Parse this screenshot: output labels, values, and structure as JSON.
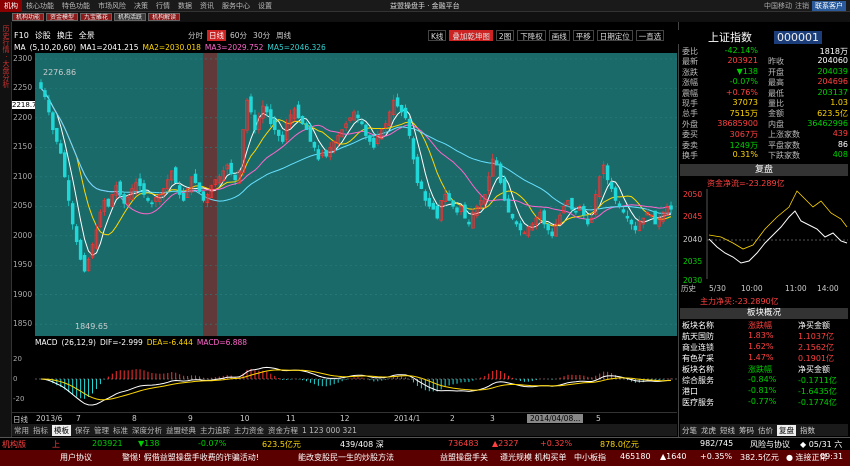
{
  "app": {
    "logo": "机构",
    "title": "益盟操盘手 · 金融平台"
  },
  "menu": [
    "核心功能",
    "特色功能",
    "市场风险",
    "决策",
    "行情",
    "数据",
    "资讯",
    "服务中心",
    "设置"
  ],
  "top_right": {
    "label": "中国移动",
    "btn": "联系客户",
    "user": "注销"
  },
  "toolbar2": [
    "机构功能",
    "资金模型",
    "九宝雕花",
    "机构活跃",
    "机构解读"
  ],
  "left_strip_text": "历史行情 · 大盘分析",
  "chart_head": {
    "code": "F10",
    "items": [
      "诊股",
      "换庄",
      "全景"
    ]
  },
  "periods": [
    "分时",
    "日线",
    "60分",
    "30分",
    "周线"
  ],
  "period_active": "日线",
  "right_controls": [
    "K线",
    "叠加乾坤图",
    "2图",
    "下降权",
    "画线",
    "平移",
    "日期定位",
    "一直选"
  ],
  "ma_line": {
    "label": "MA",
    "params": "(5,10,20,60)",
    "ma1": "MA1=2041.215",
    "ma2": "MA2=2030.018",
    "ma3": "MA3=2029.752",
    "ma5": "MA5=2046.326"
  },
  "y_ticks": [
    "2300",
    "2250",
    "2200",
    "2150",
    "2100",
    "2050",
    "2000",
    "1950",
    "1900",
    "1850"
  ],
  "price_marks": {
    "high": "2276.86",
    "low": "1849.65",
    "cursor": "2218.79"
  },
  "macd_head": {
    "label": "MACD",
    "params": "(26,12,9)",
    "dif": "DIF=-2.999",
    "dea": "DEA=-6.444",
    "macd": "MACD=6.888"
  },
  "macd_ticks": [
    "20",
    "0",
    "-20"
  ],
  "x_labels": [
    "日线",
    "2013/6",
    "7",
    "8",
    "9",
    "10",
    "11",
    "12",
    "2014/1",
    "2",
    "3",
    "2014/04/08...",
    "5"
  ],
  "bottom_tabs": [
    "常用",
    "指标",
    "模板",
    "保存",
    "管理",
    "标准",
    "深度分析",
    "益盟经典",
    "主力追踪",
    "主力资金",
    "资金方程",
    "1 123 000 321"
  ],
  "bottom_tab_active": "模板",
  "index": {
    "name": "上证指数",
    "code": "000001"
  },
  "quotes": [
    {
      "l": "委比",
      "v": "-42.14%",
      "c": "green",
      "l2": "",
      "v2": "1818万",
      "c2": "wht"
    },
    {
      "l": "最新",
      "v": "203921",
      "c": "red",
      "l2": "昨收",
      "v2": "204060",
      "c2": "wht"
    },
    {
      "l": "涨跌",
      "v": "▼138",
      "c": "green",
      "l2": "开盘",
      "v2": "204039",
      "c2": "green"
    },
    {
      "l": "涨幅",
      "v": "-0.07%",
      "c": "green",
      "l2": "最高",
      "v2": "204696",
      "c2": "red"
    },
    {
      "l": "震幅",
      "v": "+0.76%",
      "c": "red",
      "l2": "最低",
      "v2": "203137",
      "c2": "green"
    },
    {
      "l": "现手",
      "v": "37073",
      "c": "yel",
      "l2": "量比",
      "v2": "1.03",
      "c2": "yel"
    },
    {
      "l": "总手",
      "v": "7515万",
      "c": "yel",
      "l2": "金额",
      "v2": "623.5亿",
      "c2": "yel"
    },
    {
      "l": "外盘",
      "v": "38685900",
      "c": "red",
      "l2": "内盘",
      "v2": "36462996",
      "c2": "green"
    },
    {
      "l": "委买",
      "v": "3067万",
      "c": "red",
      "l2": "上涨家数",
      "v2": "439",
      "c2": "red"
    },
    {
      "l": "委卖",
      "v": "1249万",
      "c": "green",
      "l2": "平盘家数",
      "v2": "86",
      "c2": "wht"
    },
    {
      "l": "换手",
      "v": "0.31%",
      "c": "yel",
      "l2": "下跌家数",
      "v2": "408",
      "c2": "green"
    }
  ],
  "fupan": {
    "title": "复盘",
    "net_label": "资金净流=-23.289亿",
    "main_label": "主力净买:-23.2890亿",
    "history": "历史",
    "date": "5/30",
    "t1": "10:00",
    "t2": "11:00",
    "t3": "14:00",
    "ticks": [
      "2050",
      "2045",
      "2040",
      "2035",
      "2030"
    ]
  },
  "bankuai": {
    "title": "板块概况",
    "header": [
      "板块名称",
      "涨跌幅",
      "净买金额"
    ],
    "header2": [
      "板块名称",
      "涨跌幅",
      "净买金额"
    ],
    "rows_up": [
      [
        "航天国防",
        "1.83%",
        "1.1037亿"
      ],
      [
        "商业连锁",
        "1.62%",
        "2.1562亿"
      ],
      [
        "有色矿采",
        "1.47%",
        "0.1901亿"
      ]
    ],
    "rows_down": [
      [
        "综合服务",
        "-0.84%",
        "-0.1711亿"
      ],
      [
        "港口",
        "-0.81%",
        "-1.6435亿"
      ],
      [
        "医疗服务",
        "-0.77%",
        "-0.1774亿"
      ]
    ]
  },
  "right_bottom_tabs": [
    "分笔",
    "龙虎",
    "短线",
    "筹码",
    "估价",
    "复盘",
    "指数"
  ],
  "right_bottom_active": "复盘",
  "ticker1": [
    {
      "t": "机构版",
      "c": "red"
    },
    {
      "t": "上",
      "c": "red"
    },
    {
      "t": "203921",
      "c": "green"
    },
    {
      "t": "▼138",
      "c": "green"
    },
    {
      "t": "-0.07%",
      "c": "green"
    },
    {
      "t": "623.5亿元",
      "c": "yel"
    },
    {
      "t": "439/408 深",
      "c": "wht"
    },
    {
      "t": "736483",
      "c": "red"
    },
    {
      "t": "▲2327",
      "c": "red"
    },
    {
      "t": "+0.32%",
      "c": "red"
    },
    {
      "t": "878.0亿元",
      "c": "yel"
    },
    {
      "t": "982/745",
      "c": "wht"
    },
    {
      "t": "风险与协议",
      "c": "wht"
    },
    {
      "t": "◆ 05/31 六",
      "c": "wht"
    }
  ],
  "ticker2": [
    {
      "t": "用户协议",
      "c": "wht"
    },
    {
      "t": "警惕! 假借益盟操盘手收费的诈骗活动!",
      "c": "wht"
    },
    {
      "t": "能改变股民一生的炒股方法",
      "c": "wht"
    },
    {
      "t": "益盟操盘手关",
      "c": "wht"
    },
    {
      "t": "遵光规模 机构买单",
      "c": "wht"
    },
    {
      "t": "中小板指",
      "c": "wht"
    },
    {
      "t": "465180",
      "c": "wht"
    },
    {
      "t": "▲1640",
      "c": "wht"
    },
    {
      "t": "+0.35%",
      "c": "wht"
    },
    {
      "t": "382.5亿元",
      "c": "wht"
    },
    {
      "t": "● 连接正常",
      "c": "wht"
    },
    {
      "t": "09:31",
      "c": "wht"
    }
  ],
  "chart_data": {
    "type": "candlestick",
    "ylim": [
      1830,
      2310
    ],
    "close": [
      2250,
      2236,
      2210,
      2180,
      2160,
      2140,
      2100,
      2060,
      2020,
      1990,
      1960,
      1940,
      1960,
      1985,
      2010,
      2040,
      2060,
      2050,
      2070,
      2085,
      2070,
      2055,
      2065,
      2080,
      2090,
      2085,
      2070,
      2060,
      2055,
      2065,
      2070,
      2080,
      2095,
      2110,
      2090,
      2070,
      2060,
      2080,
      2100,
      2090,
      2075,
      2060,
      2070,
      2085,
      2095,
      2100,
      2110,
      2120,
      2105,
      2095,
      2110,
      2180,
      2230,
      2210,
      2180,
      2200,
      2220,
      2210,
      2190,
      2180,
      2170,
      2160,
      2190,
      2205,
      2215,
      2200,
      2190,
      2180,
      2160,
      2150,
      2130,
      2140,
      2135,
      2150,
      2160,
      2170,
      2180,
      2190,
      2200,
      2210,
      2200,
      2190,
      2170,
      2160,
      2150,
      2170,
      2180,
      2190,
      2210,
      2230,
      2220,
      2210,
      2200,
      2170,
      2130,
      2090,
      2080,
      2060,
      2050,
      2045,
      2030,
      2060,
      2070,
      2060,
      2050,
      2040,
      2050,
      2030,
      2020,
      2040,
      2050,
      2060,
      2070,
      2100,
      2130,
      2120,
      2090,
      2060,
      2040,
      2030,
      2020,
      2010,
      2005,
      2015,
      2020,
      2030,
      2040,
      2020,
      2010,
      2000,
      2020,
      2035,
      2050,
      2060,
      2045,
      2040,
      2050,
      2035,
      2020,
      2030,
      2070,
      2100,
      2120,
      2095,
      2080,
      2060,
      2050,
      2040,
      2030,
      2020,
      2010,
      2025,
      2030,
      2040,
      2035,
      2020,
      2030,
      2040,
      2050,
      2045
    ]
  }
}
